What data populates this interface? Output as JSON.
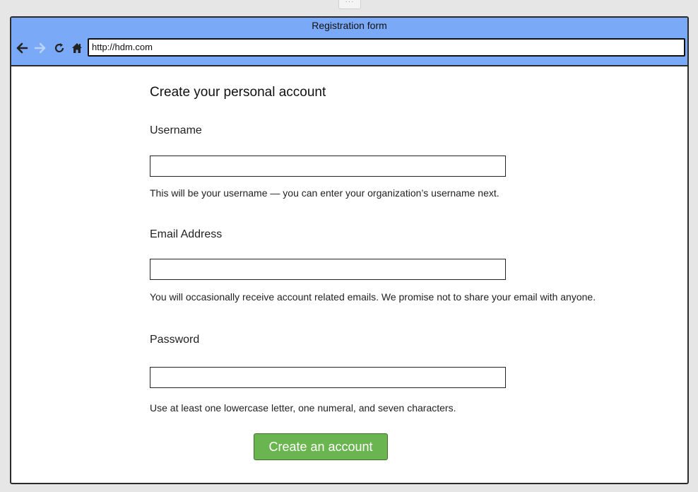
{
  "window": {
    "title": "Registration form",
    "url": "http://hdm.com",
    "nav_icons": [
      "back-arrow-icon",
      "forward-arrow-icon",
      "refresh-icon",
      "home-icon"
    ]
  },
  "form": {
    "heading": "Create your personal account",
    "username": {
      "label": "Username",
      "value": "",
      "hint": "This will be your username — you can enter your organization’s username next."
    },
    "email": {
      "label": "Email Address",
      "value": "",
      "hint": "You will occasionally receive account related emails. We promise not to share your email with anyone."
    },
    "password": {
      "label": "Password",
      "value": "",
      "hint": "Use at least one lowercase letter, one numeral, and seven characters."
    },
    "submit_label": "Create an account"
  },
  "colors": {
    "titlebar": "#7aa9f7",
    "button": "#6ab54f",
    "border": "#2b2b2b"
  }
}
